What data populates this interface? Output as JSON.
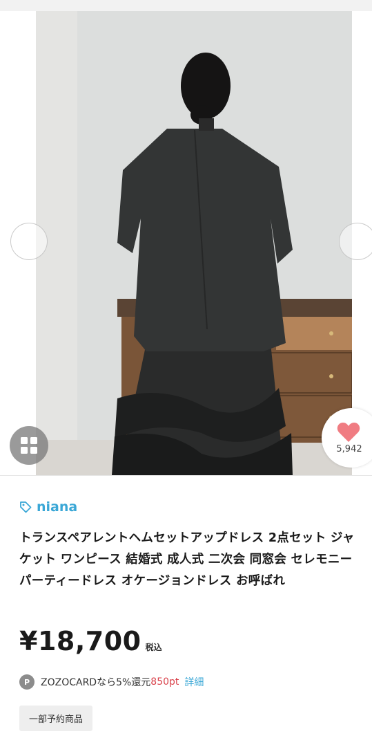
{
  "gallery": {
    "prev_icon": "chevron-left-icon",
    "next_icon": "chevron-right-icon",
    "grid_icon": "grid-icon",
    "favorite": {
      "icon": "heart-icon",
      "count": "5,942",
      "color": "#f07c82"
    }
  },
  "product": {
    "brand_icon": "tag-icon",
    "brand": "niana",
    "title": "トランスペアレントヘムセットアップドレス 2点セット ジャケット ワンピース 結婚式 成人式 二次会 同窓会 セレモニー パーティードレス オケージョンドレス お呼ばれ",
    "price": "¥18,700",
    "tax_label": "税込",
    "points": {
      "badge": "P",
      "text": "ZOZOCARDなら5%還元",
      "value": "850pt",
      "detail_link": "詳細"
    },
    "tag": "一部予約商品"
  },
  "colors": {
    "link": "#3aa7d6",
    "points": "#d9434c"
  }
}
